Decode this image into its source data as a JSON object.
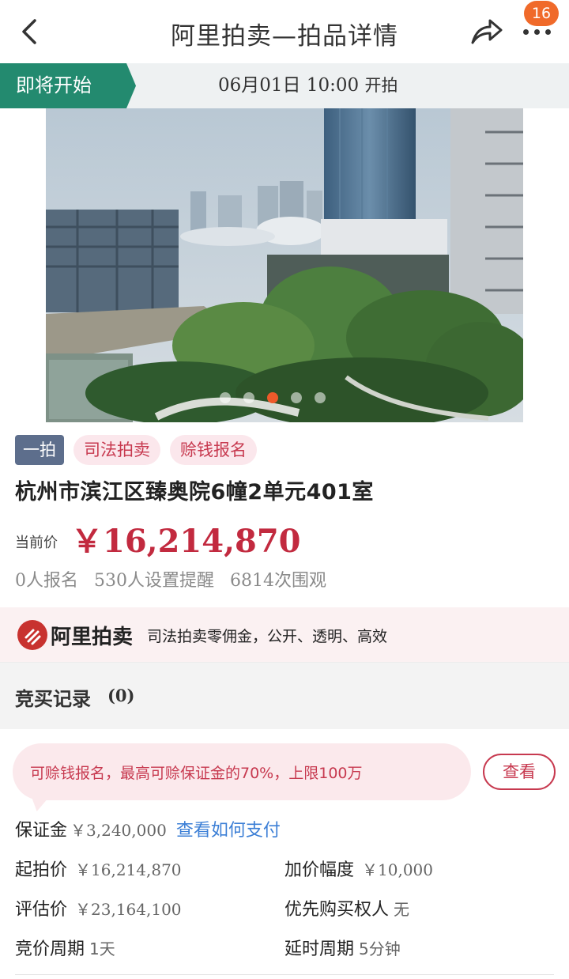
{
  "nav": {
    "title": "阿里拍卖—拍品详情",
    "badge_count": "16",
    "back_icon": "chevron-left-icon",
    "share_icon": "share-icon",
    "more_icon": "more-dots-icon"
  },
  "status": {
    "tag": "即将开始",
    "time": "06月01日 10:00",
    "suffix": "开拍",
    "color": "#238a6f"
  },
  "gallery": {
    "dot_count": 5,
    "active_index": 2
  },
  "item": {
    "tags": [
      "一拍",
      "司法拍卖",
      "赊钱报名"
    ],
    "title": "杭州市滨江区臻奥院6幢2单元401室",
    "price_label": "当前价",
    "price": "￥16,214,870",
    "stats": [
      "0人报名",
      "530人设置提醒",
      "6814次围观"
    ],
    "price_color": "#c22a3f"
  },
  "ali_banner": {
    "brand": "阿里拍卖",
    "slogan": "司法拍卖零佣金，公开、透明、高效"
  },
  "bid_record": {
    "label": "竞买记录",
    "count": "(0)"
  },
  "loan": {
    "text": "可赊钱报名，最高可赊保证金的70%，上限100万",
    "button": "查看"
  },
  "details": {
    "deposit_label": "保证金",
    "deposit_value": "￥3,240,000",
    "deposit_link": "查看如何支付",
    "start_price_label": "起拍价",
    "start_price_value": "￥16,214,870",
    "increment_label": "加价幅度",
    "increment_value": "￥10,000",
    "appraisal_label": "评估价",
    "appraisal_value": "￥23,164,100",
    "priority_label": "优先购买权人",
    "priority_value": "无",
    "period_label": "竞价周期",
    "period_value": "1天",
    "delay_label": "延时周期",
    "delay_value": "5分钟"
  }
}
